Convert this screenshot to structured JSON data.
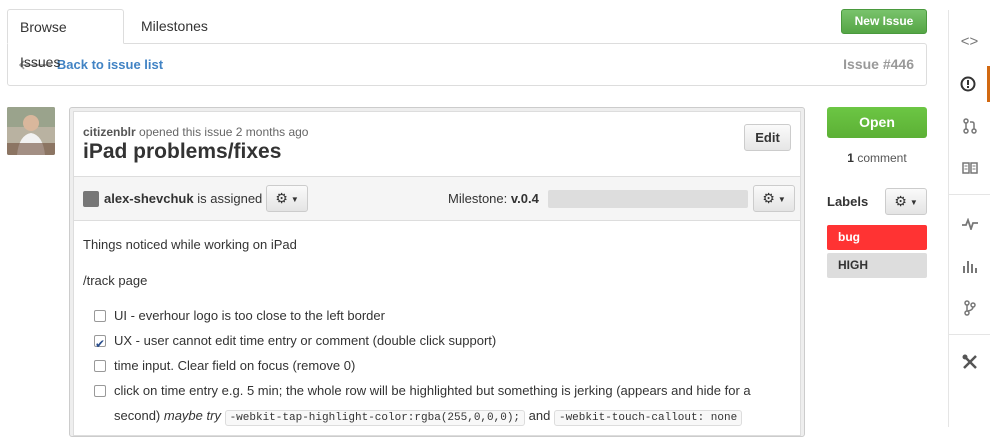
{
  "tabs": {
    "browse_issues": "Browse Issues",
    "milestones": "Milestones"
  },
  "toolbar": {
    "new_issue": "New Issue"
  },
  "header": {
    "back_arrow": "🡐",
    "back_label": "Back to issue list",
    "issue_number": "Issue #446"
  },
  "issue": {
    "author": "citizenblr",
    "opened_text": "opened this issue 2 months ago",
    "title": "iPad problems/fixes",
    "edit_label": "Edit",
    "assignee": "alex-shevchuk",
    "assigned_text": "is assigned",
    "milestone_label": "Milestone:",
    "milestone_value": "v.0.4",
    "milestone_progress": 0,
    "body_line1": "Things noticed while working on iPad",
    "body_line2": "/track page",
    "tasks": [
      {
        "text": "UI - everhour logo is too close to the left border",
        "checked": false
      },
      {
        "text": "UX - user cannot edit time entry or comment (double click support)",
        "checked": true
      },
      {
        "text": "time input. Clear field on focus (remove 0)",
        "checked": false
      },
      {
        "text": "click on time entry e.g. 5 min; the whole row will be highlighted but something is jerking (appears and hide for a",
        "checked": false
      }
    ],
    "task4_line2_prefix": "second)",
    "task4_maybe": "maybe try",
    "task4_code1": "-webkit-tap-highlight-color:rgba(255,0,0,0);",
    "task4_and": "and",
    "task4_code2": "-webkit-touch-callout: none"
  },
  "sidebar": {
    "status": "Open",
    "comment_count": "1",
    "comment_word": "comment",
    "labels_title": "Labels",
    "labels": [
      {
        "name": "bug",
        "color": "#ff3333"
      },
      {
        "name": "HIGH",
        "color": "#dddddd"
      }
    ]
  },
  "rail": {
    "icons": [
      "code-icon",
      "issues-icon",
      "pull-request-icon",
      "wiki-icon",
      "pulse-icon",
      "graphs-icon",
      "network-icon",
      "settings-icon"
    ]
  },
  "colors": {
    "accent_green": "#6cc644",
    "link_blue": "#4183c4",
    "rail_active": "#d26911"
  }
}
